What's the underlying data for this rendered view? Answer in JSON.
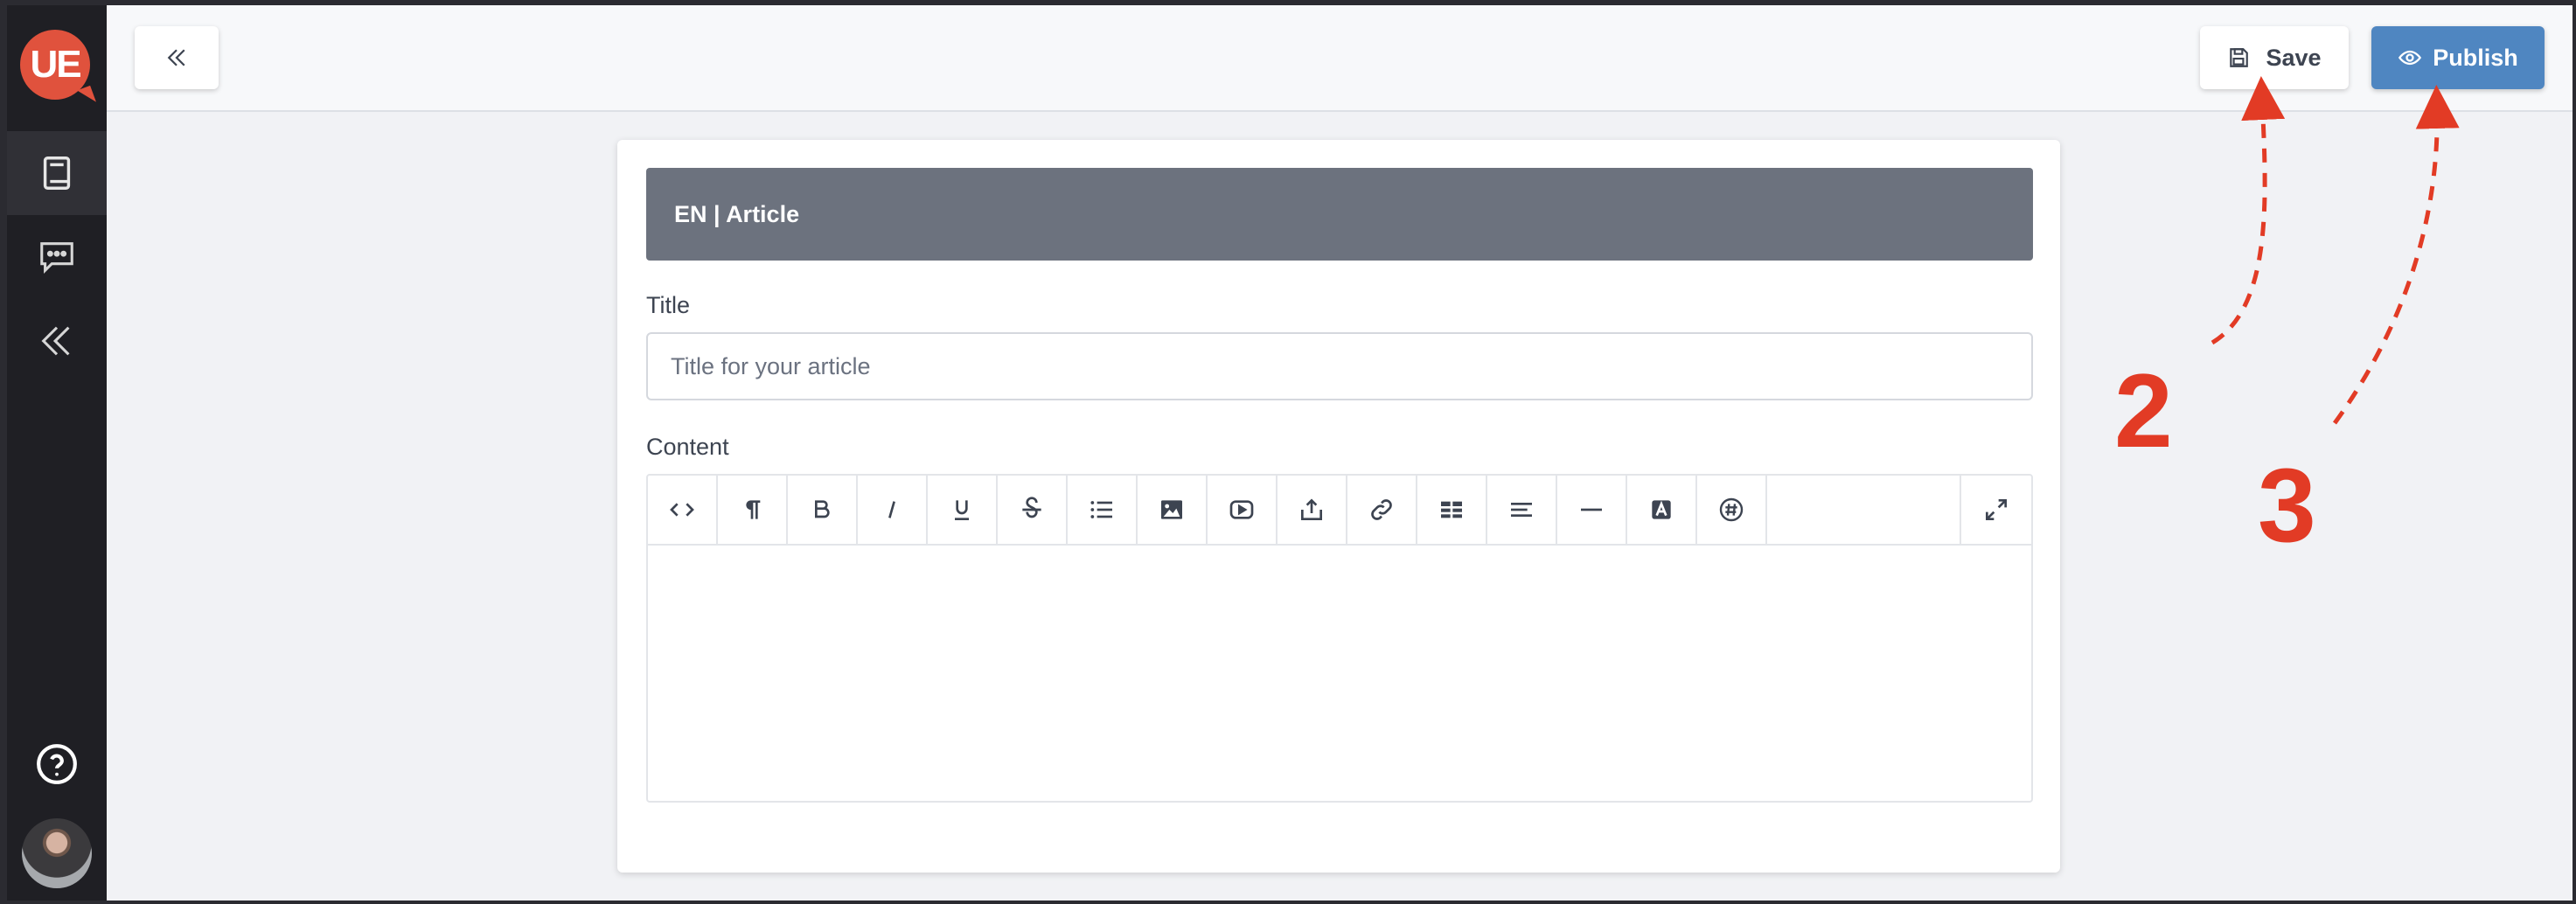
{
  "sidebar": {
    "logo_text": "UE",
    "items": [
      {
        "icon": "book-icon",
        "active": true
      },
      {
        "icon": "chat-icon",
        "active": false
      },
      {
        "icon": "double-chevron-left-icon",
        "active": false
      }
    ],
    "help_icon": "question-circle-icon",
    "avatar": "user-avatar"
  },
  "toolbar": {
    "collapse_icon": "double-chevron-left-icon",
    "save_label": "Save",
    "publish_label": "Publish"
  },
  "card": {
    "header": "EN | Article",
    "title_label": "Title",
    "title_placeholder": "Title for your article",
    "content_label": "Content",
    "editor_tools": [
      "code",
      "paragraph",
      "bold",
      "italic",
      "underline",
      "strikethrough",
      "list",
      "image",
      "video",
      "upload",
      "link",
      "table",
      "align",
      "horizontal-rule",
      "text-color",
      "hashtag",
      "fullscreen"
    ]
  },
  "annotations": [
    {
      "label": "2"
    },
    {
      "label": "3"
    }
  ],
  "colors": {
    "sidebar_bg": "#1f1f24",
    "accent_logo": "#e0523d",
    "publish_bg": "#4f86c1",
    "header_bg": "#6c727e",
    "annotation": "#e23b25"
  }
}
